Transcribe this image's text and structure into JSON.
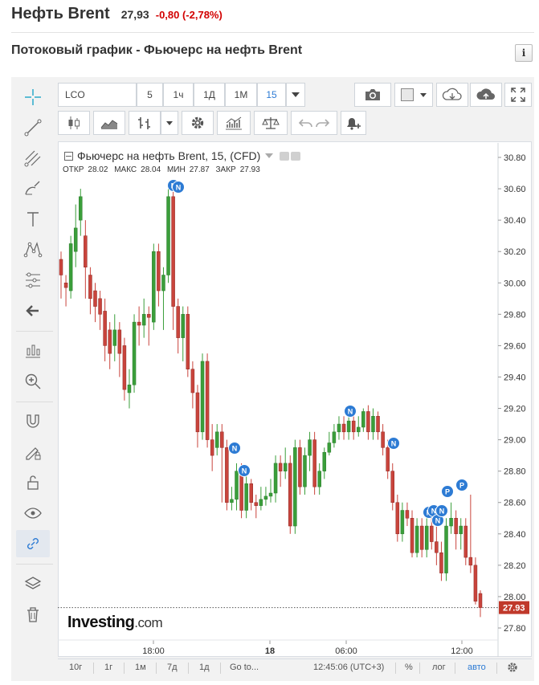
{
  "header": {
    "title": "Нефть Brent",
    "price": "27,93",
    "change": "-0,80 (-2,78%)"
  },
  "subtitle": "Потоковый график - Фьючерс на нефть Brent",
  "info_icon": "i",
  "toolbar": {
    "symbol": "LCO",
    "intervals": [
      "5",
      "1ч",
      "1Д",
      "1М",
      "15"
    ],
    "active_interval": "15"
  },
  "legend": {
    "name": "Фьючерс на нефть Brent, 15, (CFD)",
    "open_label": "ОТКР",
    "open": "28.02",
    "high_label": "МАКС",
    "high": "28.04",
    "low_label": "МИН",
    "low": "27.87",
    "close_label": "ЗАКР",
    "close": "27.93"
  },
  "logo": {
    "main": "Investing",
    "suffix": ".com"
  },
  "price_axis": {
    "ticks": [
      "30.80",
      "30.60",
      "30.40",
      "30.20",
      "30.00",
      "29.80",
      "29.60",
      "29.40",
      "29.20",
      "29.00",
      "28.80",
      "28.60",
      "28.40",
      "28.20",
      "28.00",
      "27.80"
    ],
    "current": "27.93"
  },
  "time_axis": {
    "ticks": [
      "18:00",
      "18",
      "06:00",
      "12:00"
    ]
  },
  "bottom_bar": {
    "ranges": [
      "10г",
      "1г",
      "1м",
      "7д",
      "1д"
    ],
    "goto": "Go to...",
    "time": "12:45:06 (UTC+3)",
    "percent": "%",
    "log": "лог",
    "auto": "авто"
  },
  "news_markers": [
    "N",
    "N",
    "N",
    "N",
    "N",
    "N",
    "N",
    "N",
    "N",
    "N",
    "P",
    "P"
  ],
  "colors": {
    "up": "#3a9e3a",
    "down": "#c9443c",
    "accent": "#2d7bd4",
    "negative": "#d20000"
  },
  "chart_data": {
    "type": "candlestick",
    "interval": "15",
    "ylim": [
      27.7,
      30.9
    ],
    "candles": [
      [
        30.15,
        30.05,
        30.2,
        29.9
      ],
      [
        30.0,
        29.97,
        30.05,
        29.85
      ],
      [
        29.95,
        30.25,
        30.3,
        29.9
      ],
      [
        30.2,
        30.35,
        30.5,
        30.1
      ],
      [
        30.4,
        30.55,
        30.6,
        30.3
      ],
      [
        30.3,
        30.1,
        30.4,
        29.9
      ],
      [
        30.05,
        29.9,
        30.1,
        29.8
      ],
      [
        29.95,
        29.85,
        30.0,
        29.75
      ],
      [
        29.9,
        29.8,
        29.95,
        29.7
      ],
      [
        29.82,
        29.6,
        29.9,
        29.5
      ],
      [
        29.7,
        29.55,
        29.75,
        29.45
      ],
      [
        29.6,
        29.7,
        29.8,
        29.5
      ],
      [
        29.7,
        29.55,
        29.75,
        29.4
      ],
      [
        29.6,
        29.32,
        29.65,
        29.25
      ],
      [
        29.3,
        29.35,
        29.45,
        29.2
      ],
      [
        29.35,
        29.75,
        29.8,
        29.3
      ],
      [
        29.75,
        29.73,
        29.85,
        29.6
      ],
      [
        29.73,
        29.8,
        29.9,
        29.65
      ],
      [
        29.8,
        29.78,
        29.85,
        29.6
      ],
      [
        29.75,
        30.2,
        30.25,
        29.7
      ],
      [
        30.2,
        29.95,
        30.25,
        29.85
      ],
      [
        29.95,
        30.05,
        30.1,
        29.7
      ],
      [
        30.05,
        30.55,
        30.6,
        30.0
      ],
      [
        30.55,
        29.85,
        30.6,
        29.7
      ],
      [
        29.85,
        29.65,
        29.9,
        29.55
      ],
      [
        29.65,
        29.8,
        29.85,
        29.5
      ],
      [
        29.8,
        29.45,
        29.85,
        29.4
      ],
      [
        29.45,
        29.3,
        29.5,
        29.2
      ],
      [
        29.3,
        29.05,
        29.35,
        28.95
      ],
      [
        29.05,
        29.5,
        29.55,
        29.0
      ],
      [
        29.5,
        29.0,
        29.55,
        28.95
      ],
      [
        29.0,
        28.9,
        29.1,
        28.8
      ],
      [
        28.95,
        29.05,
        29.1,
        28.9
      ],
      [
        29.05,
        28.95,
        29.1,
        28.6
      ],
      [
        28.95,
        28.6,
        29.0,
        28.55
      ],
      [
        28.6,
        28.62,
        28.7,
        28.55
      ],
      [
        28.62,
        28.8,
        28.85,
        28.55
      ],
      [
        28.8,
        28.55,
        28.85,
        28.5
      ],
      [
        28.55,
        28.72,
        28.8,
        28.5
      ],
      [
        28.72,
        28.6,
        28.75,
        28.55
      ],
      [
        28.6,
        28.58,
        28.65,
        28.5
      ],
      [
        28.58,
        28.62,
        28.7,
        28.55
      ],
      [
        28.62,
        28.64,
        28.7,
        28.58
      ],
      [
        28.64,
        28.66,
        28.75,
        28.6
      ],
      [
        28.66,
        28.85,
        28.9,
        28.6
      ],
      [
        28.85,
        28.8,
        28.9,
        28.7
      ],
      [
        28.8,
        28.85,
        28.95,
        28.75
      ],
      [
        28.85,
        28.45,
        28.9,
        28.4
      ],
      [
        28.45,
        28.95,
        29.0,
        28.4
      ],
      [
        28.95,
        28.7,
        29.0,
        28.65
      ],
      [
        28.7,
        28.9,
        28.95,
        28.65
      ],
      [
        28.9,
        29.0,
        29.05,
        28.8
      ],
      [
        29.0,
        28.7,
        29.05,
        28.65
      ],
      [
        28.7,
        28.8,
        28.85,
        28.65
      ],
      [
        28.8,
        28.92,
        28.95,
        28.75
      ],
      [
        28.92,
        28.98,
        29.05,
        28.9
      ],
      [
        28.98,
        29.05,
        29.1,
        28.95
      ],
      [
        29.05,
        29.1,
        29.15,
        29.0
      ],
      [
        29.1,
        29.05,
        29.15,
        29.0
      ],
      [
        29.05,
        29.12,
        29.15,
        29.0
      ],
      [
        29.12,
        29.05,
        29.2,
        29.0
      ],
      [
        29.05,
        29.08,
        29.15,
        29.02
      ],
      [
        29.08,
        29.18,
        29.2,
        29.05
      ],
      [
        29.18,
        29.05,
        29.22,
        29.0
      ],
      [
        29.05,
        29.15,
        29.2,
        29.0
      ],
      [
        29.15,
        29.05,
        29.18,
        29.0
      ],
      [
        29.05,
        28.95,
        29.1,
        28.9
      ],
      [
        28.95,
        28.8,
        29.0,
        28.75
      ],
      [
        28.8,
        28.6,
        28.85,
        28.55
      ],
      [
        28.6,
        28.4,
        28.65,
        28.35
      ],
      [
        28.4,
        28.55,
        28.6,
        28.35
      ],
      [
        28.55,
        28.5,
        28.6,
        28.45
      ],
      [
        28.5,
        28.28,
        28.55,
        28.25
      ],
      [
        28.28,
        28.45,
        28.5,
        28.25
      ],
      [
        28.45,
        28.3,
        28.5,
        28.25
      ],
      [
        28.3,
        28.45,
        28.5,
        28.25
      ],
      [
        28.45,
        28.35,
        28.5,
        28.3
      ],
      [
        28.35,
        28.28,
        28.45,
        28.2
      ],
      [
        28.28,
        28.15,
        28.35,
        28.1
      ],
      [
        28.15,
        28.45,
        28.5,
        28.1
      ],
      [
        28.45,
        28.5,
        28.6,
        28.4
      ],
      [
        28.5,
        28.4,
        28.55,
        28.3
      ],
      [
        28.4,
        28.45,
        28.5,
        28.3
      ],
      [
        28.45,
        28.25,
        28.5,
        28.2
      ],
      [
        28.25,
        28.2,
        28.65,
        28.15
      ],
      [
        28.2,
        27.97,
        28.25,
        27.95
      ],
      [
        28.02,
        27.93,
        28.04,
        27.87
      ]
    ]
  }
}
